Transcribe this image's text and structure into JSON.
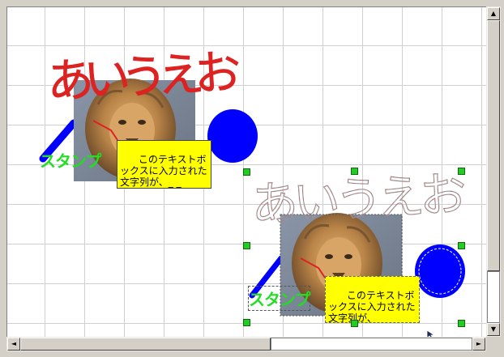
{
  "canvas": {
    "handwriting_text": "あいうえお",
    "stamp_text": "スタンプ",
    "textbox_text": "このテキストボックスに入力された文字列が、",
    "textbox_cursor": "_ _",
    "handwriting_color": "#dd2222",
    "copy_handwriting_color": "#bbbbbb",
    "stamp_color": "#22dd22",
    "textbox_color": "#ffff00",
    "circle_color": "#0000ff",
    "handle_color": "#22cc22"
  },
  "scrollbars": {
    "up_arrow": "▲",
    "down_arrow": "▼",
    "left_arrow": "◄",
    "right_arrow": "►"
  }
}
